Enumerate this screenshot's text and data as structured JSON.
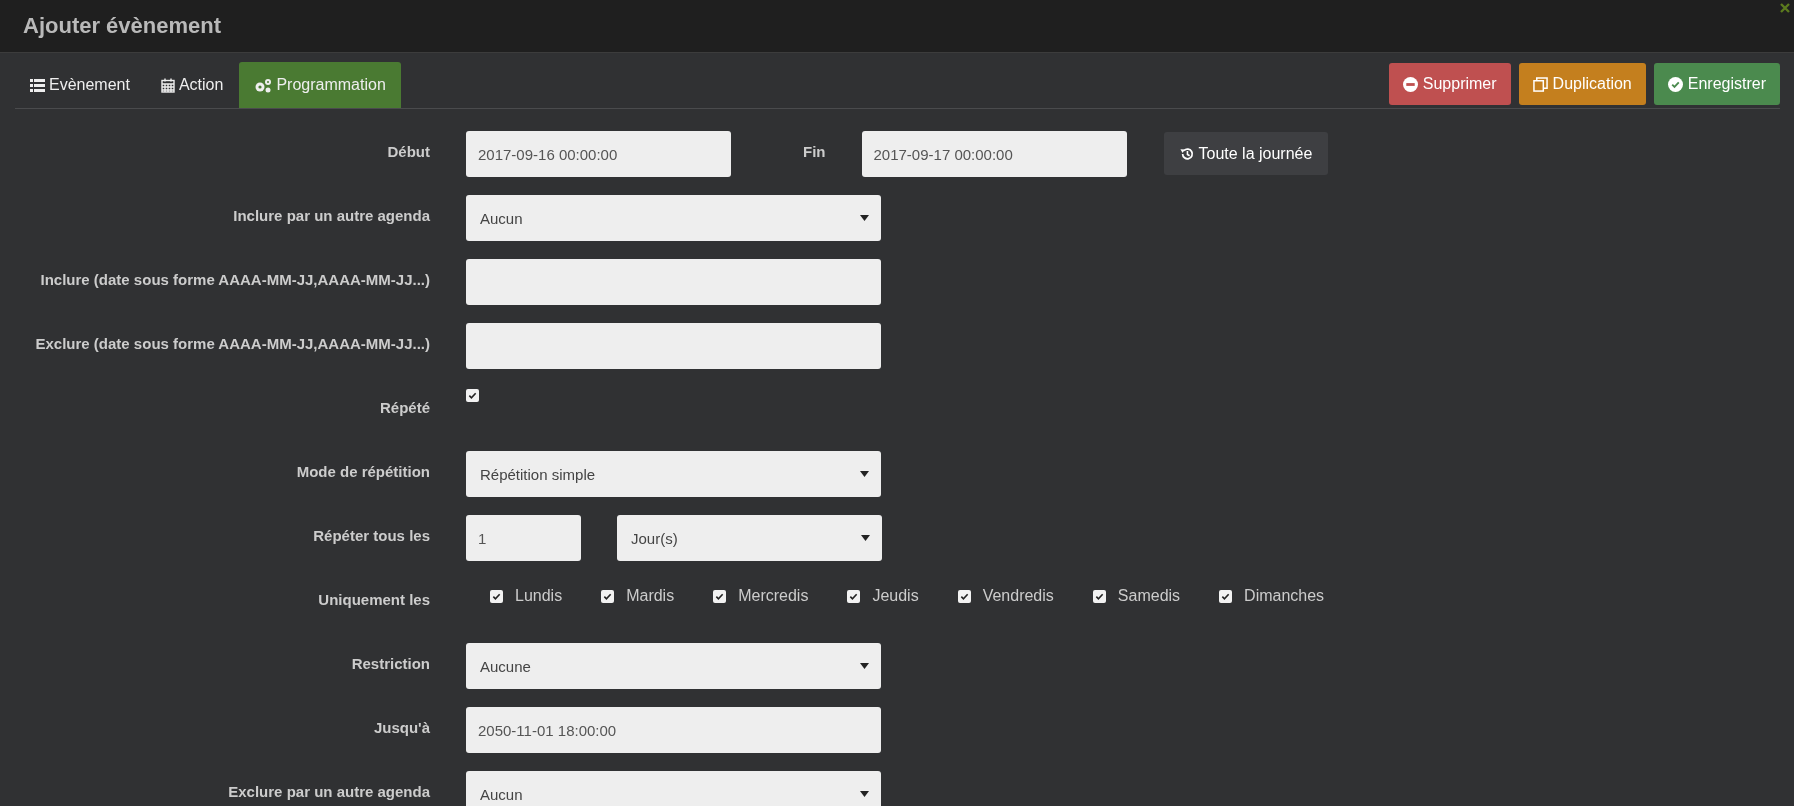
{
  "window": {
    "title": "Ajouter évènement"
  },
  "tabs": [
    {
      "label": "Evènement",
      "selected": false
    },
    {
      "label": "Action",
      "selected": false
    },
    {
      "label": "Programmation",
      "selected": true
    }
  ],
  "actions": [
    {
      "label": "Supprimer",
      "kind": "danger"
    },
    {
      "label": "Duplication",
      "kind": "warning"
    },
    {
      "label": "Enregistrer",
      "kind": "success"
    }
  ],
  "form": [
    {
      "kind": "range",
      "label": "Début",
      "value": "2017-09-16 00:00:00",
      "end_label": "Fin",
      "end_value": "2017-09-17 00:00:00",
      "button": "Toute la journée"
    },
    {
      "kind": "select",
      "label": "Inclure par un autre agenda",
      "value": "Aucun"
    },
    {
      "kind": "text",
      "label": "Inclure (date sous forme AAAA-MM-JJ,AAAA-MM-JJ...)"
    },
    {
      "kind": "text",
      "label": "Exclure (date sous forme AAAA-MM-JJ,AAAA-MM-JJ...)"
    },
    {
      "kind": "checkbox",
      "label": "Répété",
      "checked": true
    },
    {
      "kind": "select",
      "label": "Mode de répétition",
      "value": "Répétition simple"
    },
    {
      "kind": "number-unit",
      "label": "Répéter tous les",
      "value": "1",
      "unit": "Jour(s)"
    },
    {
      "kind": "days",
      "label": "Uniquement les",
      "days": [
        {
          "label": "Lundis",
          "checked": true
        },
        {
          "label": "Mardis",
          "checked": true
        },
        {
          "label": "Mercredis",
          "checked": true
        },
        {
          "label": "Jeudis",
          "checked": true
        },
        {
          "label": "Vendredis",
          "checked": true
        },
        {
          "label": "Samedis",
          "checked": true
        },
        {
          "label": "Dimanches",
          "checked": true
        }
      ]
    },
    {
      "kind": "select",
      "label": "Restriction",
      "value": "Aucune"
    },
    {
      "kind": "text",
      "label": "Jusqu'à",
      "value": "2050-11-01 18:00:00"
    },
    {
      "kind": "select",
      "label": "Exclure par un autre agenda",
      "value": "Aucun"
    }
  ]
}
